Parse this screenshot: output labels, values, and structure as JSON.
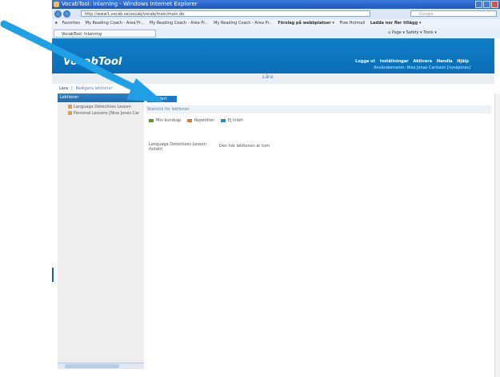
{
  "window": {
    "title": "VocabTool: Inlarning - Windows Internet Explorer"
  },
  "browser": {
    "url": "http://www1.vocab.se/vocab/vocab/main/main.do",
    "search_placeholder": "Google",
    "favorites_label": "Favorites",
    "favorites": [
      "My Reading Coach - Area Pr...",
      "My Reading Coach - Area Pr...",
      "My Reading Coach - Area Pr...",
      "Förslag på webbplatser ▾",
      "Free Hotmail",
      "Ladda ner fler tillägg ▾"
    ],
    "tab_label": "VocabTool: Inlarning",
    "tools": [
      "Page ▾",
      "Safety ▾",
      "Tools ▾"
    ]
  },
  "app": {
    "logo": "VocabTool",
    "topnav": [
      "Logga ut",
      "Inställningar",
      "Aktivera",
      "Handla",
      "Hjälp"
    ],
    "user_line": "Användarnamn: Nisa Jonas Carlsson [nysajonas]",
    "page_title": "Lära",
    "subnav": [
      "Lära",
      "Redigera lektioner"
    ],
    "colors": {
      "header": "#0f7fc8",
      "accent": "#1b78c4",
      "link": "#4a86c5"
    }
  },
  "sidebar": {
    "title": "Lektioner",
    "lessons": [
      "Language Detectives Lesson",
      "Personal Lessons [Nisa Jones Car"
    ]
  },
  "main": {
    "start_button": "Start",
    "stat_header": "Statistik för lektioner",
    "legend": [
      {
        "label": "Min kunskap",
        "color": "#5a9a2a"
      },
      {
        "label": "Repetition",
        "color": "#e0782a"
      },
      {
        "label": "Ej inlärt",
        "color": "#2a8ad0"
      }
    ],
    "lesson_name": "Language Detectives Lesson",
    "lesson_total": "(totalt)",
    "lesson_status": "Den här lektionen är tom"
  }
}
